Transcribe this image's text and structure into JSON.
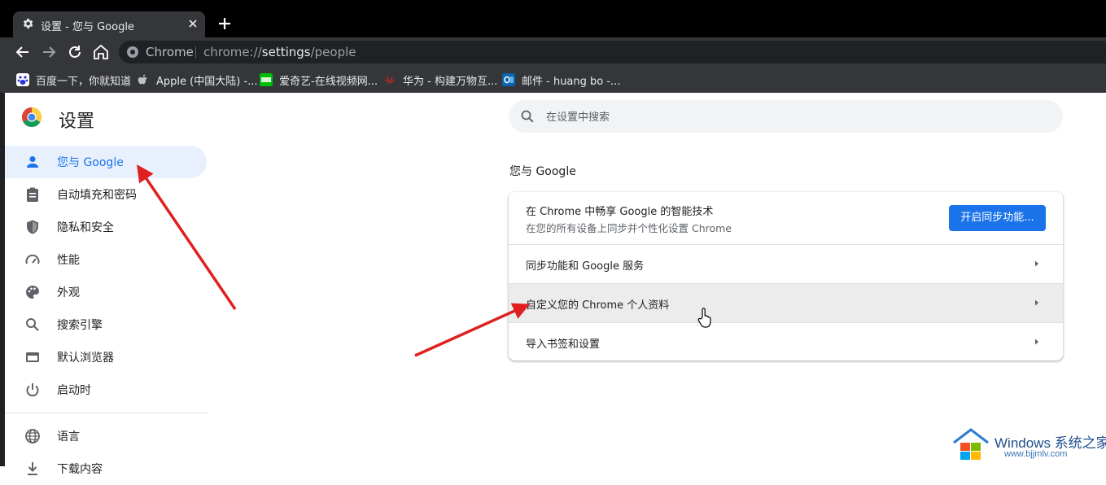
{
  "tab": {
    "title": "设置 - 您与 Google",
    "icon": "gear-icon"
  },
  "omnibox": {
    "chip": "Chrome",
    "url_scheme": "chrome://",
    "url_host": "settings",
    "url_path": "/people"
  },
  "bookmarks": [
    {
      "label": "百度一下，你就知道",
      "icon": "baidu-icon"
    },
    {
      "label": "Apple (中国大陆) -...",
      "icon": "apple-icon"
    },
    {
      "label": "爱奇艺-在线视频网...",
      "icon": "iqiyi-icon"
    },
    {
      "label": "华为 - 构建万物互...",
      "icon": "huawei-icon"
    },
    {
      "label": "邮件 - huang bo -...",
      "icon": "outlook-icon"
    }
  ],
  "sidebar": {
    "title": "设置",
    "items": [
      {
        "label": "您与 Google",
        "icon": "person-icon",
        "active": true
      },
      {
        "label": "自动填充和密码",
        "icon": "clipboard-icon"
      },
      {
        "label": "隐私和安全",
        "icon": "shield-icon"
      },
      {
        "label": "性能",
        "icon": "speedometer-icon"
      },
      {
        "label": "外观",
        "icon": "palette-icon"
      },
      {
        "label": "搜索引擎",
        "icon": "search-icon"
      },
      {
        "label": "默认浏览器",
        "icon": "browser-icon"
      },
      {
        "label": "启动时",
        "icon": "power-icon"
      },
      {
        "label": "语言",
        "icon": "globe-icon"
      },
      {
        "label": "下载内容",
        "icon": "download-icon"
      }
    ]
  },
  "search": {
    "placeholder": "在设置中搜索"
  },
  "main": {
    "section_title": "您与 Google",
    "sync_card": {
      "title": "在 Chrome 中畅享 Google 的智能技术",
      "subtitle": "在您的所有设备上同步并个性化设置 Chrome",
      "button": "开启同步功能..."
    },
    "rows": [
      {
        "label": "同步功能和 Google 服务"
      },
      {
        "label": "自定义您的 Chrome 个人资料"
      },
      {
        "label": "导入书签和设置"
      }
    ]
  },
  "colors": {
    "accent": "#1a73e8",
    "annotation_arrow": "#e02020",
    "active_nav_bg": "#e8f0fe"
  },
  "watermark": {
    "line1": "Windows 系统之家",
    "line2": "www.bjjmlv.com"
  }
}
